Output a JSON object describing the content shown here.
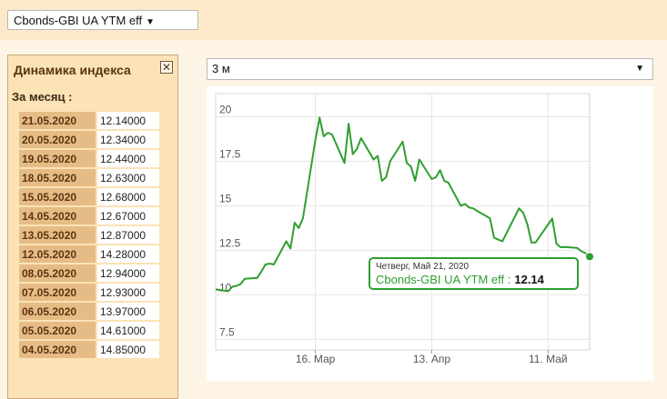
{
  "index_select": {
    "value": "Cbonds-GBI UA YTM eff",
    "arrow_icon": "caret-down-icon"
  },
  "panel": {
    "title": "Динамика индекса",
    "close_icon": "close-box-icon",
    "subtitle": "За месяц :",
    "rows": [
      {
        "date": "21.05.2020",
        "value": "12.14000"
      },
      {
        "date": "20.05.2020",
        "value": "12.34000"
      },
      {
        "date": "19.05.2020",
        "value": "12.44000"
      },
      {
        "date": "18.05.2020",
        "value": "12.63000"
      },
      {
        "date": "15.05.2020",
        "value": "12.68000"
      },
      {
        "date": "14.05.2020",
        "value": "12.67000"
      },
      {
        "date": "13.05.2020",
        "value": "12.87000"
      },
      {
        "date": "12.05.2020",
        "value": "14.28000"
      },
      {
        "date": "08.05.2020",
        "value": "12.94000"
      },
      {
        "date": "07.05.2020",
        "value": "12.93000"
      },
      {
        "date": "06.05.2020",
        "value": "13.97000"
      },
      {
        "date": "05.05.2020",
        "value": "14.61000"
      },
      {
        "date": "04.05.2020",
        "value": "14.85000"
      }
    ]
  },
  "period_select": {
    "value": "3 м",
    "arrow_icon": "caret-down-icon"
  },
  "chart_data": {
    "type": "line",
    "title": "",
    "xlabel": "",
    "ylabel": "",
    "ylim": [
      6.9,
      21.3
    ],
    "yticks": [
      "7.5",
      "10",
      "12.5",
      "15",
      "17.5",
      "20"
    ],
    "ytick_values": [
      7.5,
      10,
      12.5,
      15,
      17.5,
      20
    ],
    "xticks": [
      {
        "label": "16. Мар",
        "x": "2020-03-16"
      },
      {
        "label": "13. Апр",
        "x": "2020-04-13"
      },
      {
        "label": "11. Май",
        "x": "2020-05-11"
      }
    ],
    "xlim": [
      "2020-02-21",
      "2020-05-21"
    ],
    "grid": true,
    "line_color": "#2f9e2f",
    "series": [
      {
        "name": "Cbonds-GBI UA YTM eff",
        "points": [
          [
            "2020-02-21",
            10.3
          ],
          [
            "2020-02-24",
            10.2
          ],
          [
            "2020-02-25",
            10.45
          ],
          [
            "2020-02-26",
            10.5
          ],
          [
            "2020-02-27",
            10.6
          ],
          [
            "2020-02-28",
            10.9
          ],
          [
            "2020-03-02",
            10.95
          ],
          [
            "2020-03-03",
            11.3
          ],
          [
            "2020-03-04",
            11.7
          ],
          [
            "2020-03-05",
            11.75
          ],
          [
            "2020-03-06",
            11.7
          ],
          [
            "2020-03-09",
            13.0
          ],
          [
            "2020-03-10",
            12.6
          ],
          [
            "2020-03-11",
            14.05
          ],
          [
            "2020-03-12",
            13.75
          ],
          [
            "2020-03-13",
            14.3
          ],
          [
            "2020-03-16",
            18.7
          ],
          [
            "2020-03-17",
            19.95
          ],
          [
            "2020-03-18",
            18.9
          ],
          [
            "2020-03-19",
            19.1
          ],
          [
            "2020-03-20",
            19.0
          ],
          [
            "2020-03-23",
            17.4
          ],
          [
            "2020-03-24",
            19.6
          ],
          [
            "2020-03-25",
            17.9
          ],
          [
            "2020-03-26",
            18.2
          ],
          [
            "2020-03-27",
            18.8
          ],
          [
            "2020-03-30",
            17.6
          ],
          [
            "2020-03-31",
            17.8
          ],
          [
            "2020-04-01",
            16.4
          ],
          [
            "2020-04-02",
            16.6
          ],
          [
            "2020-04-03",
            17.5
          ],
          [
            "2020-04-06",
            18.6
          ],
          [
            "2020-04-07",
            17.4
          ],
          [
            "2020-04-08",
            17.2
          ],
          [
            "2020-04-09",
            16.4
          ],
          [
            "2020-04-10",
            17.6
          ],
          [
            "2020-04-13",
            16.5
          ],
          [
            "2020-04-14",
            16.6
          ],
          [
            "2020-04-15",
            17.0
          ],
          [
            "2020-04-16",
            16.4
          ],
          [
            "2020-04-17",
            16.3
          ],
          [
            "2020-04-20",
            15.0
          ],
          [
            "2020-04-21",
            15.1
          ],
          [
            "2020-04-22",
            14.9
          ],
          [
            "2020-04-23",
            14.85
          ],
          [
            "2020-04-24",
            14.7
          ],
          [
            "2020-04-27",
            14.3
          ],
          [
            "2020-04-28",
            13.2
          ],
          [
            "2020-04-29",
            13.1
          ],
          [
            "2020-04-30",
            13.0
          ],
          [
            "2020-05-04",
            14.85
          ],
          [
            "2020-05-05",
            14.61
          ],
          [
            "2020-05-06",
            13.97
          ],
          [
            "2020-05-07",
            12.93
          ],
          [
            "2020-05-08",
            12.94
          ],
          [
            "2020-05-12",
            14.28
          ],
          [
            "2020-05-13",
            12.87
          ],
          [
            "2020-05-14",
            12.67
          ],
          [
            "2020-05-15",
            12.68
          ],
          [
            "2020-05-18",
            12.63
          ],
          [
            "2020-05-19",
            12.44
          ],
          [
            "2020-05-20",
            12.34
          ],
          [
            "2020-05-21",
            12.14
          ]
        ]
      }
    ]
  },
  "tooltip": {
    "date": "Четверг, Май 21, 2020",
    "series": "Cbonds-GBI UA YTM eff :",
    "value": "12.14"
  }
}
